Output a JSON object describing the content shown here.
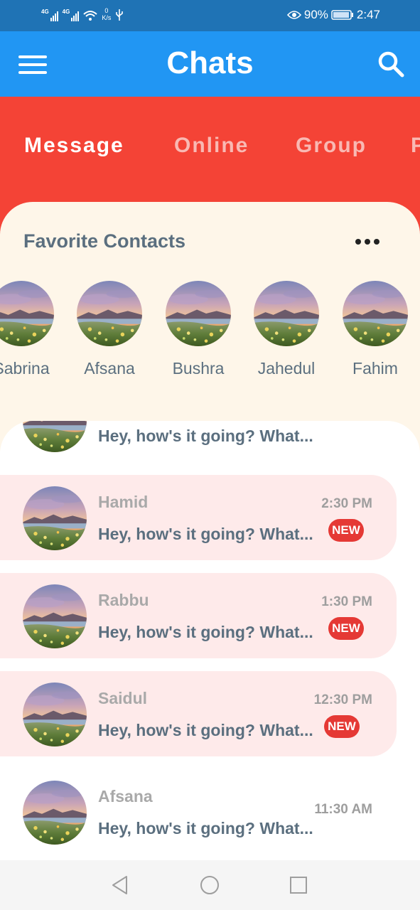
{
  "status_bar": {
    "sim1": "4G",
    "sim2": "4G",
    "speed_value": "0",
    "speed_unit": "K/s",
    "battery": "90%",
    "time": "2:47"
  },
  "app_bar": {
    "title": "Chats"
  },
  "tabs": [
    {
      "label": "Message",
      "active": true
    },
    {
      "label": "Online",
      "active": false
    },
    {
      "label": "Group",
      "active": false
    },
    {
      "label": "P",
      "active": false
    }
  ],
  "favorites": {
    "title": "Favorite Contacts",
    "contacts": [
      {
        "name": "Sabrina"
      },
      {
        "name": "Afsana"
      },
      {
        "name": "Bushra"
      },
      {
        "name": "Jahedul"
      },
      {
        "name": "Fahim"
      }
    ]
  },
  "chats": [
    {
      "name": "",
      "message": "Hey, how's it going? What...",
      "time": "",
      "unread": false
    },
    {
      "name": "Hamid",
      "message": "Hey, how's it going? What...",
      "time": "2:30 PM",
      "unread": true,
      "badge": "NEW"
    },
    {
      "name": "Rabbu",
      "message": "Hey, how's it going? What...",
      "time": "1:30 PM",
      "unread": true,
      "badge": "NEW"
    },
    {
      "name": "Saidul",
      "message": "Hey, how's it going? What...",
      "time": "12:30 PM",
      "unread": true,
      "badge": "NEW"
    },
    {
      "name": "Afsana",
      "message": "Hey, how's it going? What...",
      "time": "11:30 AM",
      "unread": false
    }
  ],
  "colors": {
    "status_bar": "#1f73b5",
    "app_bar": "#2196f3",
    "tab_bar": "#f44336",
    "favorites_bg": "#fef6e9",
    "unread_bg": "#feeaea",
    "badge": "#e53935"
  },
  "icons": {
    "menu": "menu-icon",
    "search": "search-icon",
    "more": "more-horizontal-icon",
    "nav_back": "back-triangle-icon",
    "nav_home": "home-circle-icon",
    "nav_recents": "recents-square-icon"
  }
}
